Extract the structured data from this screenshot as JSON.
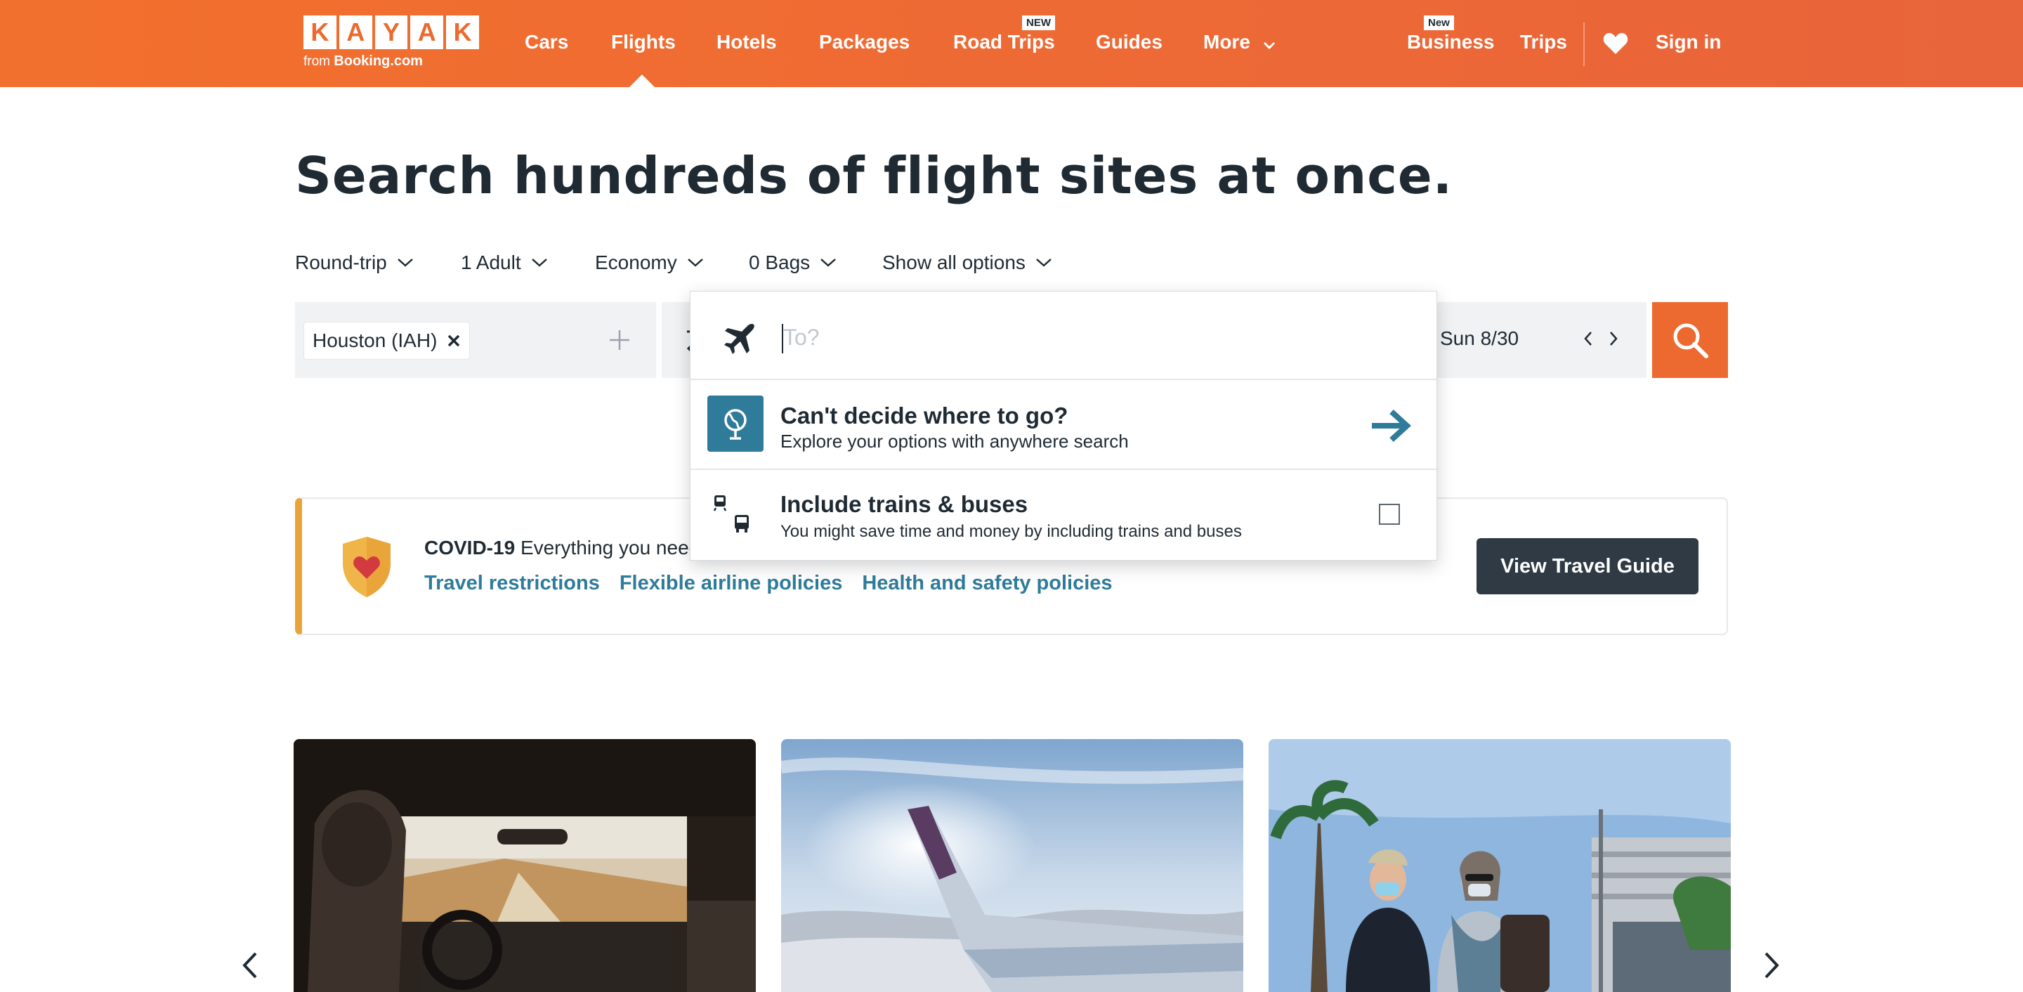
{
  "header": {
    "logo_letters": [
      "K",
      "A",
      "Y",
      "A",
      "K"
    ],
    "logo_sub_prefix": "from",
    "logo_sub_brand": "Booking.com",
    "nav": {
      "cars": "Cars",
      "flights": "Flights",
      "hotels": "Hotels",
      "packages": "Packages",
      "road_trips": "Road Trips",
      "road_trips_badge": "NEW",
      "guides": "Guides",
      "more": "More",
      "business": "Business",
      "business_badge": "New",
      "trips": "Trips",
      "sign_in": "Sign in"
    },
    "active_tab": "Flights"
  },
  "hero": {
    "title": "Search hundreds of flight sites at once."
  },
  "options": {
    "trip_type": "Round-trip",
    "travelers": "1 Adult",
    "cabin": "Economy",
    "bags": "0 Bags",
    "show_all": "Show all options"
  },
  "search": {
    "origin_chip": "Houston (IAH)",
    "destination_placeholder": "To?",
    "return_date": "Sun 8/30"
  },
  "dropdown": {
    "anywhere_title": "Can't decide where to go?",
    "anywhere_sub": "Explore your options with anywhere search",
    "trains_title": "Include trains & buses",
    "trains_sub": "You might save time and money by including trains and buses",
    "trains_checked": false
  },
  "covid": {
    "label": "COVID-19",
    "text": "Everything you need",
    "links": [
      "Travel restrictions",
      "Flexible airline policies",
      "Health and safety policies"
    ],
    "button": "View Travel Guide"
  },
  "colors": {
    "brand_orange": "#ec6a2f",
    "link_blue": "#2f7b9a",
    "dark_button": "#2f3a44",
    "covid_accent": "#e8a43a"
  },
  "icons": [
    "heart-icon",
    "chevron-down-icon",
    "plus-icon",
    "plane-icon",
    "globe-icon",
    "arrow-right-icon",
    "train-icon",
    "bus-icon",
    "search-icon",
    "shield-heart-icon",
    "chevron-left-icon",
    "chevron-right-icon"
  ]
}
